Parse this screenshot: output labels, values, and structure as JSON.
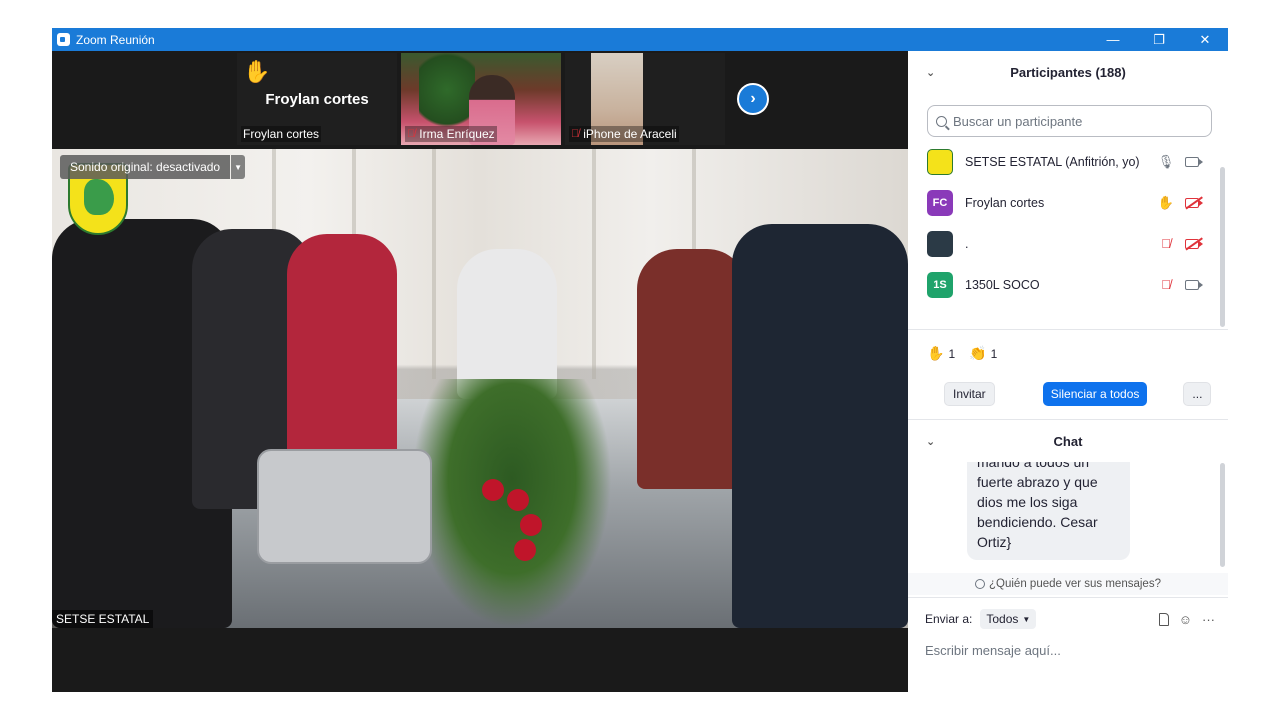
{
  "window": {
    "title": "Zoom Reunión",
    "controls": {
      "minimize": "—",
      "restore": "❐",
      "close": "✕"
    }
  },
  "strip": {
    "tiles": [
      {
        "display_name": "Froylan cortes",
        "label": "Froylan cortes",
        "raised_hand": true
      },
      {
        "label": "Irma Enríquez",
        "muted": true
      },
      {
        "label": "iPhone de Araceli",
        "muted": true
      }
    ],
    "next_label": "›"
  },
  "main_video": {
    "original_sound": "Sonido original: desactivado",
    "speaker_label": "SETSE ESTATAL"
  },
  "participants": {
    "header": "Participantes (188)",
    "search_placeholder": "Buscar un participante",
    "list": [
      {
        "avatar": "",
        "name": "SETSE ESTATAL (Anfitrión, yo)",
        "mic": "on",
        "video": "on"
      },
      {
        "avatar": "FC",
        "name": "Froylan cortes",
        "hand": true,
        "video": "off"
      },
      {
        "avatar": "",
        "name": ".",
        "mic": "off",
        "video": "off"
      },
      {
        "avatar": "1S",
        "name": "1350L SOCO",
        "mic": "off",
        "video": "on"
      }
    ],
    "reactions": [
      {
        "emoji": "✋",
        "count": "1"
      },
      {
        "emoji": "👏",
        "count": "1"
      }
    ],
    "invite_label": "Invitar",
    "mute_all_label": "Silenciar a todos",
    "more_label": "..."
  },
  "chat": {
    "header": "Chat",
    "message": "mando a todos un fuerte abrazo y que dios me los siga bendiciendo. Cesar Ortiz}",
    "who_can_see": "¿Quién puede ver sus mensajes?",
    "send_to_label": "Enviar a:",
    "send_to_value": "Todos",
    "input_placeholder": "Escribir mensaje aquí..."
  },
  "colors": {
    "titlebar": "#1a7bd8",
    "primary_button": "#0e72ed",
    "mute_red": "#e0333b"
  }
}
